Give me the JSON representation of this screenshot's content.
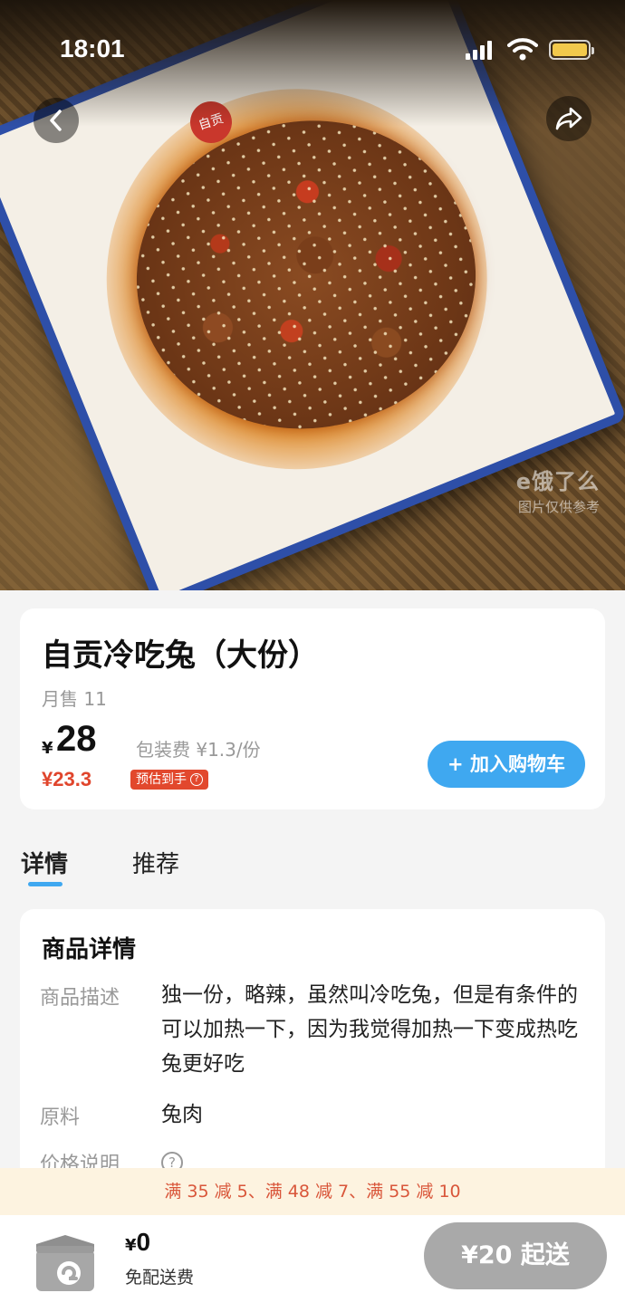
{
  "status_bar": {
    "time": "18:01"
  },
  "hero": {
    "plate_stamp": "自贡",
    "watermark_logo": "e饿了么",
    "watermark_note": "图片仅供参考",
    "back_icon": "chevron-left-icon",
    "share_icon": "share-arrow-icon"
  },
  "product": {
    "name": "自贡冷吃兔（大份）",
    "monthly_sales": "月售 11",
    "currency": "¥",
    "price": "28",
    "packing_fee": "包装费 ¥1.3/份",
    "estimated_price": "¥23.3",
    "estimated_label": "预估到手",
    "estimated_help_icon": "?",
    "add_to_cart": "+ 加入购物车"
  },
  "tabs": [
    {
      "label": "详情",
      "active": true
    },
    {
      "label": "推荐",
      "active": false
    }
  ],
  "details": {
    "title": "商品详情",
    "rows": [
      {
        "label": "商品描述",
        "value": "独一份，略辣，虽然叫冷吃兔，但是有条件的可以加热一下，因为我觉得加热一下变成热吃兔更好吃"
      },
      {
        "label": "原料",
        "value": "兔肉"
      },
      {
        "label": "价格说明",
        "value": "?"
      }
    ]
  },
  "promo": {
    "text": "满 35 减 5、满 48 减 7、满 55 减 10"
  },
  "cart_bar": {
    "currency": "¥",
    "total": "0",
    "delivery_fee": "免配送费",
    "min_order": "¥20 起送"
  },
  "colors": {
    "accent_blue": "#3fa8f0",
    "price_red": "#e0452c",
    "promo_bg": "#fdf3e0",
    "disabled_button": "#a9a9a9",
    "plate_border": "#2e4fa8"
  }
}
